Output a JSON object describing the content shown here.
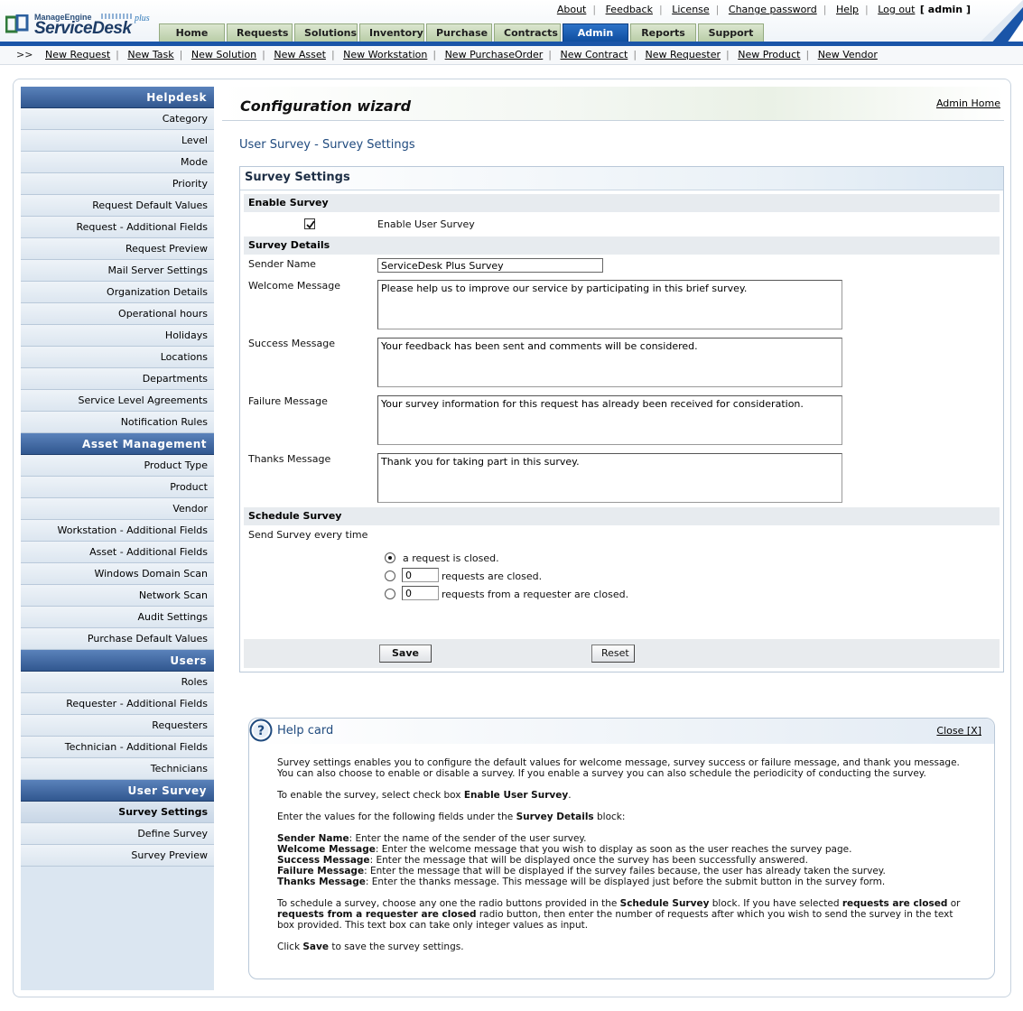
{
  "brand": {
    "company": "ManageEngine",
    "product": "ServiceDesk",
    "edition": "plus"
  },
  "top_links": [
    "About",
    "Feedback",
    "License",
    "Change password",
    "Help",
    "Log out"
  ],
  "user": "[ admin ]",
  "tabs": [
    "Home",
    "Requests",
    "Solutions",
    "Inventory",
    "Purchase",
    "Contracts",
    "Admin",
    "Reports",
    "Support"
  ],
  "active_tab": "Admin",
  "quick_arrows": ">>",
  "quick_links": [
    "New Request",
    "New Task",
    "New Solution",
    "New Asset",
    "New Workstation",
    "New PurchaseOrder",
    "New Contract",
    "New Requester",
    "New Product",
    "New Vendor"
  ],
  "sidebar": {
    "helpdesk": {
      "title": "Helpdesk",
      "items": [
        "Category",
        "Level",
        "Mode",
        "Priority",
        "Request Default Values",
        "Request - Additional Fields",
        "Request Preview",
        "Mail Server Settings",
        "Organization Details",
        "Operational hours",
        "Holidays",
        "Locations",
        "Departments",
        "Service Level Agreements",
        "Notification Rules"
      ]
    },
    "asset": {
      "title": "Asset Management",
      "items": [
        "Product Type",
        "Product",
        "Vendor",
        "Workstation - Additional Fields",
        "Asset - Additional Fields",
        "Windows Domain Scan",
        "Network Scan",
        "Audit Settings",
        "Purchase Default Values"
      ]
    },
    "users": {
      "title": "Users",
      "items": [
        "Roles",
        "Requester - Additional Fields",
        "Requesters",
        "Technician - Additional Fields",
        "Technicians"
      ]
    },
    "survey": {
      "title": "User Survey",
      "items": [
        "Survey Settings",
        "Define Survey",
        "Survey Preview"
      ]
    }
  },
  "wizard": {
    "title": "Configuration wizard",
    "admin_home": "Admin Home"
  },
  "breadcrumb": "User Survey - Survey Settings",
  "form": {
    "title": "Survey Settings",
    "enable_section": "Enable Survey",
    "enable_label": "Enable User Survey",
    "enable_checked": true,
    "details_section": "Survey Details",
    "sender_label": "Sender Name",
    "sender_value": "ServiceDesk Plus Survey",
    "welcome_label": "Welcome Message",
    "welcome_value": "Please help us to improve our service by participating in this brief survey.",
    "success_label": "Success Message",
    "success_value": "Your feedback has been sent and comments will be considered.",
    "failure_label": "Failure Message",
    "failure_value": "Your survey information for this request has already been received for consideration.",
    "thanks_label": "Thanks Message",
    "thanks_value": "Thank you for taking part in this survey.",
    "schedule_section": "Schedule Survey",
    "schedule_label": "Send Survey every time",
    "option1": "a request is closed.",
    "option2": "requests are closed.",
    "option2_value": "0",
    "option3": "requests from a requester are closed.",
    "option3_value": "0",
    "selected_option": 1,
    "save": "Save",
    "reset": "Reset"
  },
  "help": {
    "title": "Help card",
    "close": "Close  [X]",
    "p1": "Survey settings enables you to configure the default values for welcome message, survey success or failure message, and thank you message. You can also choose to enable or disable a survey. If you enable a survey you can also schedule the periodicity of conducting the survey.",
    "p2_a": "To enable the survey, select check box ",
    "p2_b": "Enable User Survey",
    "p2_c": ".",
    "p3_a": "Enter the values for the following fields under the ",
    "p3_b": "Survey Details",
    "p3_c": " block:",
    "d1_k": "Sender Name",
    "d1_v": ": Enter the name of the sender of the user survey.",
    "d2_k": "Welcome Message",
    "d2_v": ": Enter the welcome message that you wish to display as soon as the user reaches the survey page.",
    "d3_k": "Success Message",
    "d3_v": ": Enter the message that will be displayed once the survey has been successfully answered.",
    "d4_k": "Failure Message",
    "d4_v": ": Enter the message that will be displayed if the survey failes because, the user has already taken the survey.",
    "d5_k": "Thanks Message",
    "d5_v": ": Enter the thanks message. This message will be displayed just before the submit button in the survey form.",
    "p4_a": "To schedule a survey, choose any one the radio buttons provided in the ",
    "p4_b": "Schedule Survey",
    "p4_c": " block. If you have selected ",
    "p4_d": "requests are closed",
    "p4_e": " or ",
    "p4_f": "requests from a requester are closed",
    "p4_g": " radio button, then enter the number of requests after which you wish to send the survey in the text box provided. This text box can take only integer values as input.",
    "p5_a": "Click ",
    "p5_b": "Save",
    "p5_c": " to save the survey settings."
  }
}
